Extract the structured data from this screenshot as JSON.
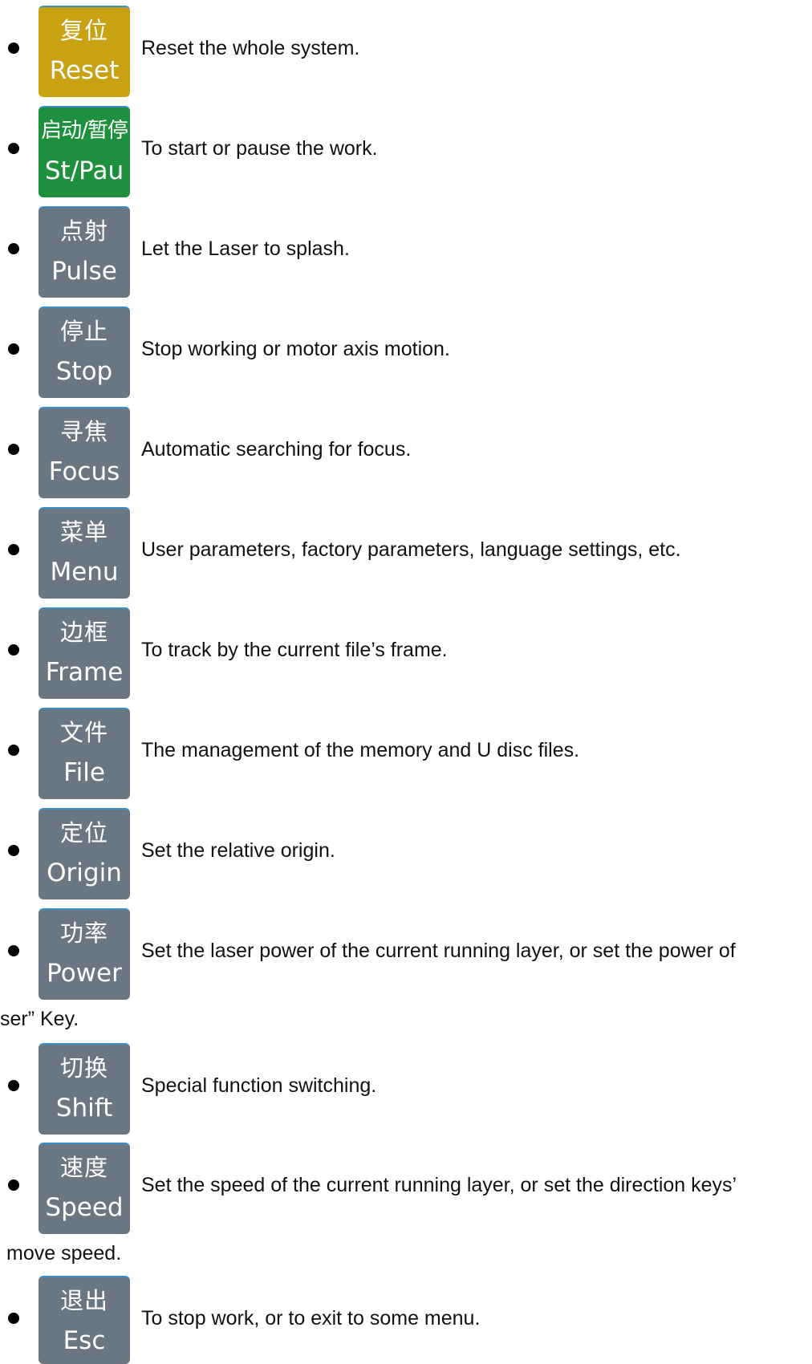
{
  "colors": {
    "reset_key": "#c9a214",
    "start_key": "#1e8f3c",
    "default_key": "#6a7681",
    "key_top_line": "#3a8fc9"
  },
  "keys": [
    {
      "cn": "复位",
      "en": "Reset",
      "desc": "Reset the whole system.",
      "color": "#c9a214"
    },
    {
      "cn": "启动/暂停",
      "en": "St/Pau",
      "desc": "To start or pause the work.",
      "color": "#1e8f3c"
    },
    {
      "cn": "点射",
      "en": "Pulse",
      "desc": "Let the Laser to splash.",
      "color": "#6a7681"
    },
    {
      "cn": "停止",
      "en": "Stop",
      "desc": "Stop working or motor axis motion.",
      "color": "#6a7681"
    },
    {
      "cn": "寻焦",
      "en": "Focus",
      "desc": "Automatic searching for focus.",
      "color": "#6a7681"
    },
    {
      "cn": "菜单",
      "en": "Menu",
      "desc": "User parameters, factory parameters, language settings, etc.",
      "color": "#6a7681"
    },
    {
      "cn": "边框",
      "en": "Frame",
      "desc": "To track by the current file’s frame.",
      "color": "#6a7681"
    },
    {
      "cn": "文件",
      "en": "File",
      "desc": "The management of the memory and U disc files.",
      "color": "#6a7681"
    },
    {
      "cn": "定位",
      "en": "Origin",
      "desc": "Set the relative origin.",
      "color": "#6a7681"
    },
    {
      "cn": "功率",
      "en": "Power",
      "desc": "Set the laser power of the current running layer, or set the power of",
      "color": "#6a7681"
    },
    {
      "cn": "切换",
      "en": "Shift",
      "desc": "Special function switching.",
      "color": "#6a7681"
    },
    {
      "cn": "速度",
      "en": "Speed",
      "desc": "Set the speed of the current running layer, or set the direction keys’",
      "color": "#6a7681"
    },
    {
      "cn": "退出",
      "en": "Esc",
      "desc": "To stop work, or to exit to some menu.",
      "color": "#6a7681"
    }
  ],
  "continuations": {
    "power": "ser” Key.",
    "speed": "move speed."
  }
}
